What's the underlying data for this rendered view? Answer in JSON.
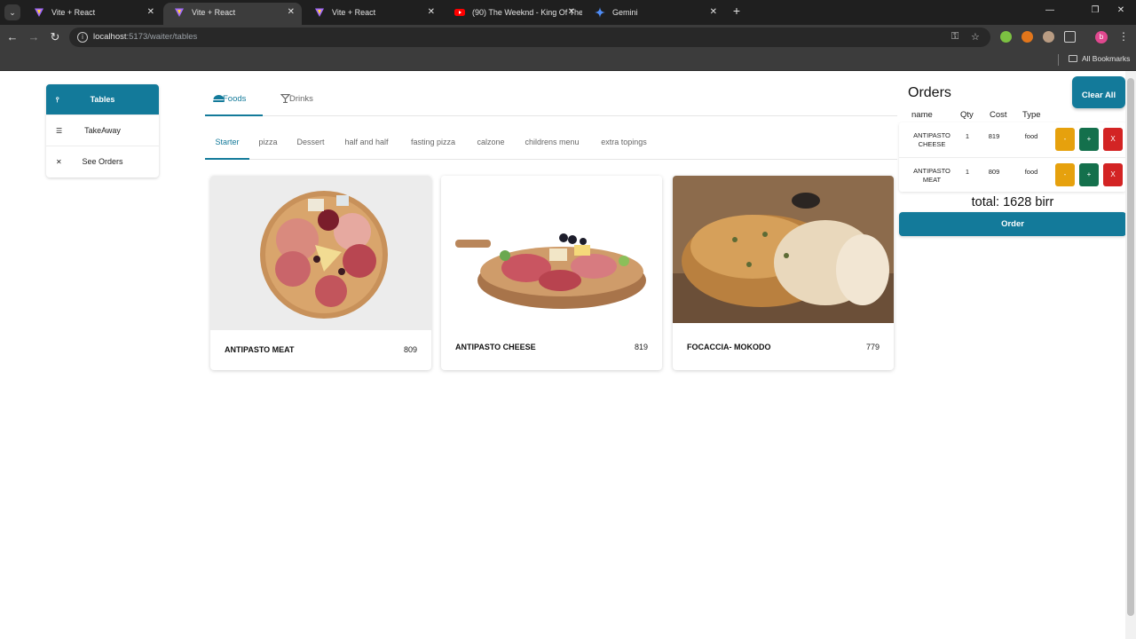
{
  "browser": {
    "tabs": [
      {
        "title": "Vite + React",
        "favicon": "vite-icon"
      },
      {
        "title": "Vite + React",
        "favicon": "vite-icon"
      },
      {
        "title": "Vite + React",
        "favicon": "vite-icon"
      },
      {
        "title": "(90) The Weeknd - King Of The",
        "favicon": "youtube-icon"
      },
      {
        "title": "Gemini",
        "favicon": "gemini-icon"
      }
    ],
    "active_tab": 1,
    "url_host": "localhost",
    "url_path": ":5173/waiter/tables",
    "profile_initial": "b",
    "bookmarks_label": "All Bookmarks"
  },
  "sidebar": {
    "items": [
      {
        "label": "Tables",
        "icon": "table-icon",
        "active": true
      },
      {
        "label": "TakeAway",
        "icon": "takeaway-icon",
        "active": false
      },
      {
        "label": "See Orders",
        "icon": "cutlery-icon",
        "active": false
      }
    ]
  },
  "category_tabs": [
    {
      "label": "Foods",
      "icon": "dish-icon",
      "active": true
    },
    {
      "label": "Drinks",
      "icon": "cocktail-icon",
      "active": false
    }
  ],
  "sub_tabs": [
    {
      "label": "Starter",
      "active": true
    },
    {
      "label": "pizza"
    },
    {
      "label": "Dessert"
    },
    {
      "label": "half and half"
    },
    {
      "label": "fasting pizza"
    },
    {
      "label": "calzone"
    },
    {
      "label": "childrens menu"
    },
    {
      "label": "extra topings"
    }
  ],
  "products": [
    {
      "name": "ANTIPASTO MEAT",
      "price": "809"
    },
    {
      "name": "ANTIPASTO CHEESE",
      "price": "819"
    },
    {
      "name": "FOCACCIA- MOKODO",
      "price": "779"
    }
  ],
  "orders": {
    "title": "Orders",
    "clear_label": "Clear All",
    "headers": {
      "name": "name",
      "qty": "Qty",
      "cost": "Cost",
      "type": "Type"
    },
    "rows": [
      {
        "name_line1": "ANTIPASTO",
        "name_line2": "CHEESE",
        "qty": "1",
        "cost": "819",
        "type": "food"
      },
      {
        "name_line1": "ANTIPASTO",
        "name_line2": "MEAT",
        "qty": "1",
        "cost": "809",
        "type": "food"
      }
    ],
    "btn_minus": "-",
    "btn_plus": "+",
    "btn_remove": "X",
    "total": "total: 1628 birr",
    "order_label": "Order"
  },
  "colors": {
    "primary": "#137a9a",
    "minus": "#e6a10d",
    "plus": "#14704c",
    "remove": "#d32424"
  }
}
